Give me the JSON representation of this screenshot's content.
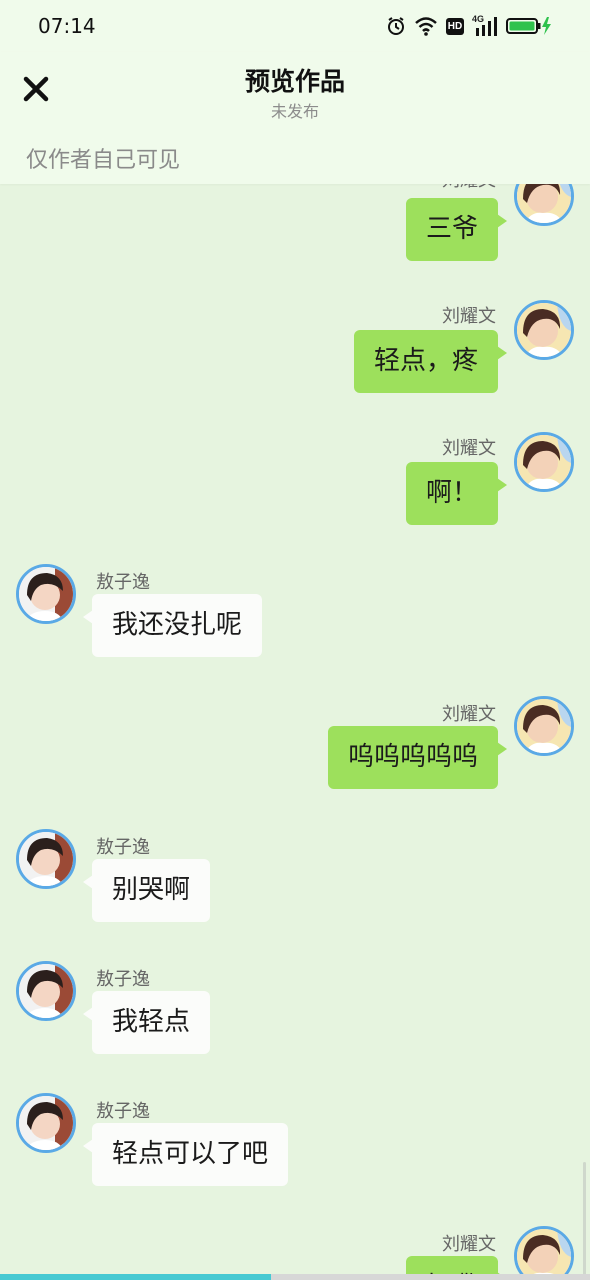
{
  "status_bar": {
    "time": "07:14",
    "icons": [
      "alarm-icon",
      "wifi-icon",
      "hd-icon",
      "4g-signal-icon",
      "battery-charging-icon"
    ],
    "network_badge": "HD",
    "network_type": "4G"
  },
  "header": {
    "close_icon": "close-icon",
    "title": "预览作品",
    "subtitle": "未发布",
    "visibility_note": "仅作者自己可见"
  },
  "characters": {
    "right": {
      "name": "刘耀文"
    },
    "left": {
      "name": "敖子逸"
    }
  },
  "messages": [
    {
      "side": "right",
      "name": "刘耀文",
      "text": "三爷"
    },
    {
      "side": "right",
      "name": "刘耀文",
      "text": "轻点，疼"
    },
    {
      "side": "right",
      "name": "刘耀文",
      "text": "啊！"
    },
    {
      "side": "left",
      "name": "敖子逸",
      "text": "我还没扎呢"
    },
    {
      "side": "right",
      "name": "刘耀文",
      "text": "呜呜呜呜呜"
    },
    {
      "side": "left",
      "name": "敖子逸",
      "text": "别哭啊"
    },
    {
      "side": "left",
      "name": "敖子逸",
      "text": "我轻点"
    },
    {
      "side": "left",
      "name": "敖子逸",
      "text": "轻点可以了吧"
    },
    {
      "side": "right",
      "name": "刘耀文",
      "text": "好嘞"
    }
  ],
  "progress": {
    "fraction": 0.46
  },
  "colors": {
    "background": "#e6f4df",
    "header_background": "#f0fbeb",
    "right_bubble": "#9de05c",
    "left_bubble": "#fbfcfa",
    "avatar_border": "#5aa9e6",
    "progress": "#47c9d2"
  }
}
